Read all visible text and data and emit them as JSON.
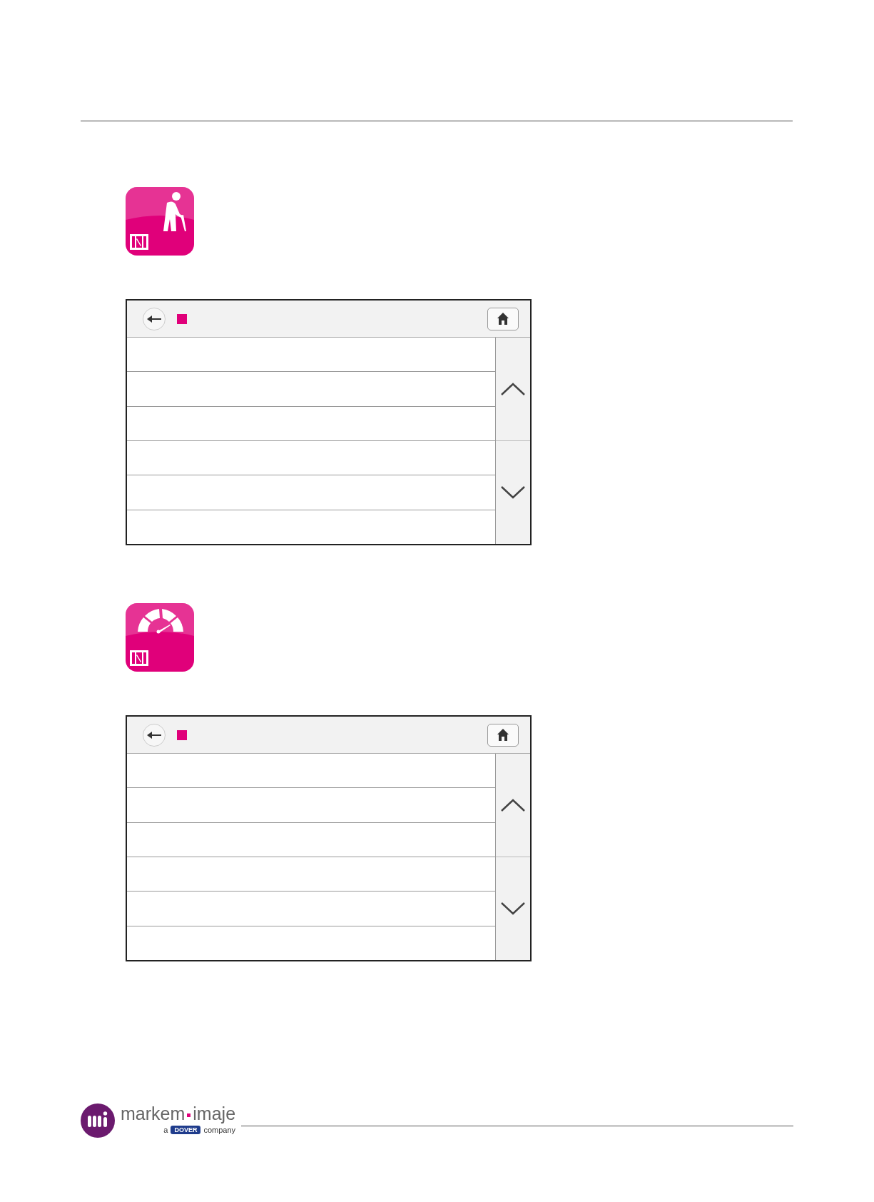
{
  "sections": [
    {
      "kind": "person"
    },
    {
      "kind": "gauge"
    }
  ],
  "footer": {
    "brand_left": "markem",
    "brand_right": "imaje",
    "tagline_prefix": "a",
    "tagline_brand": "DOVER",
    "tagline_suffix": "company"
  }
}
